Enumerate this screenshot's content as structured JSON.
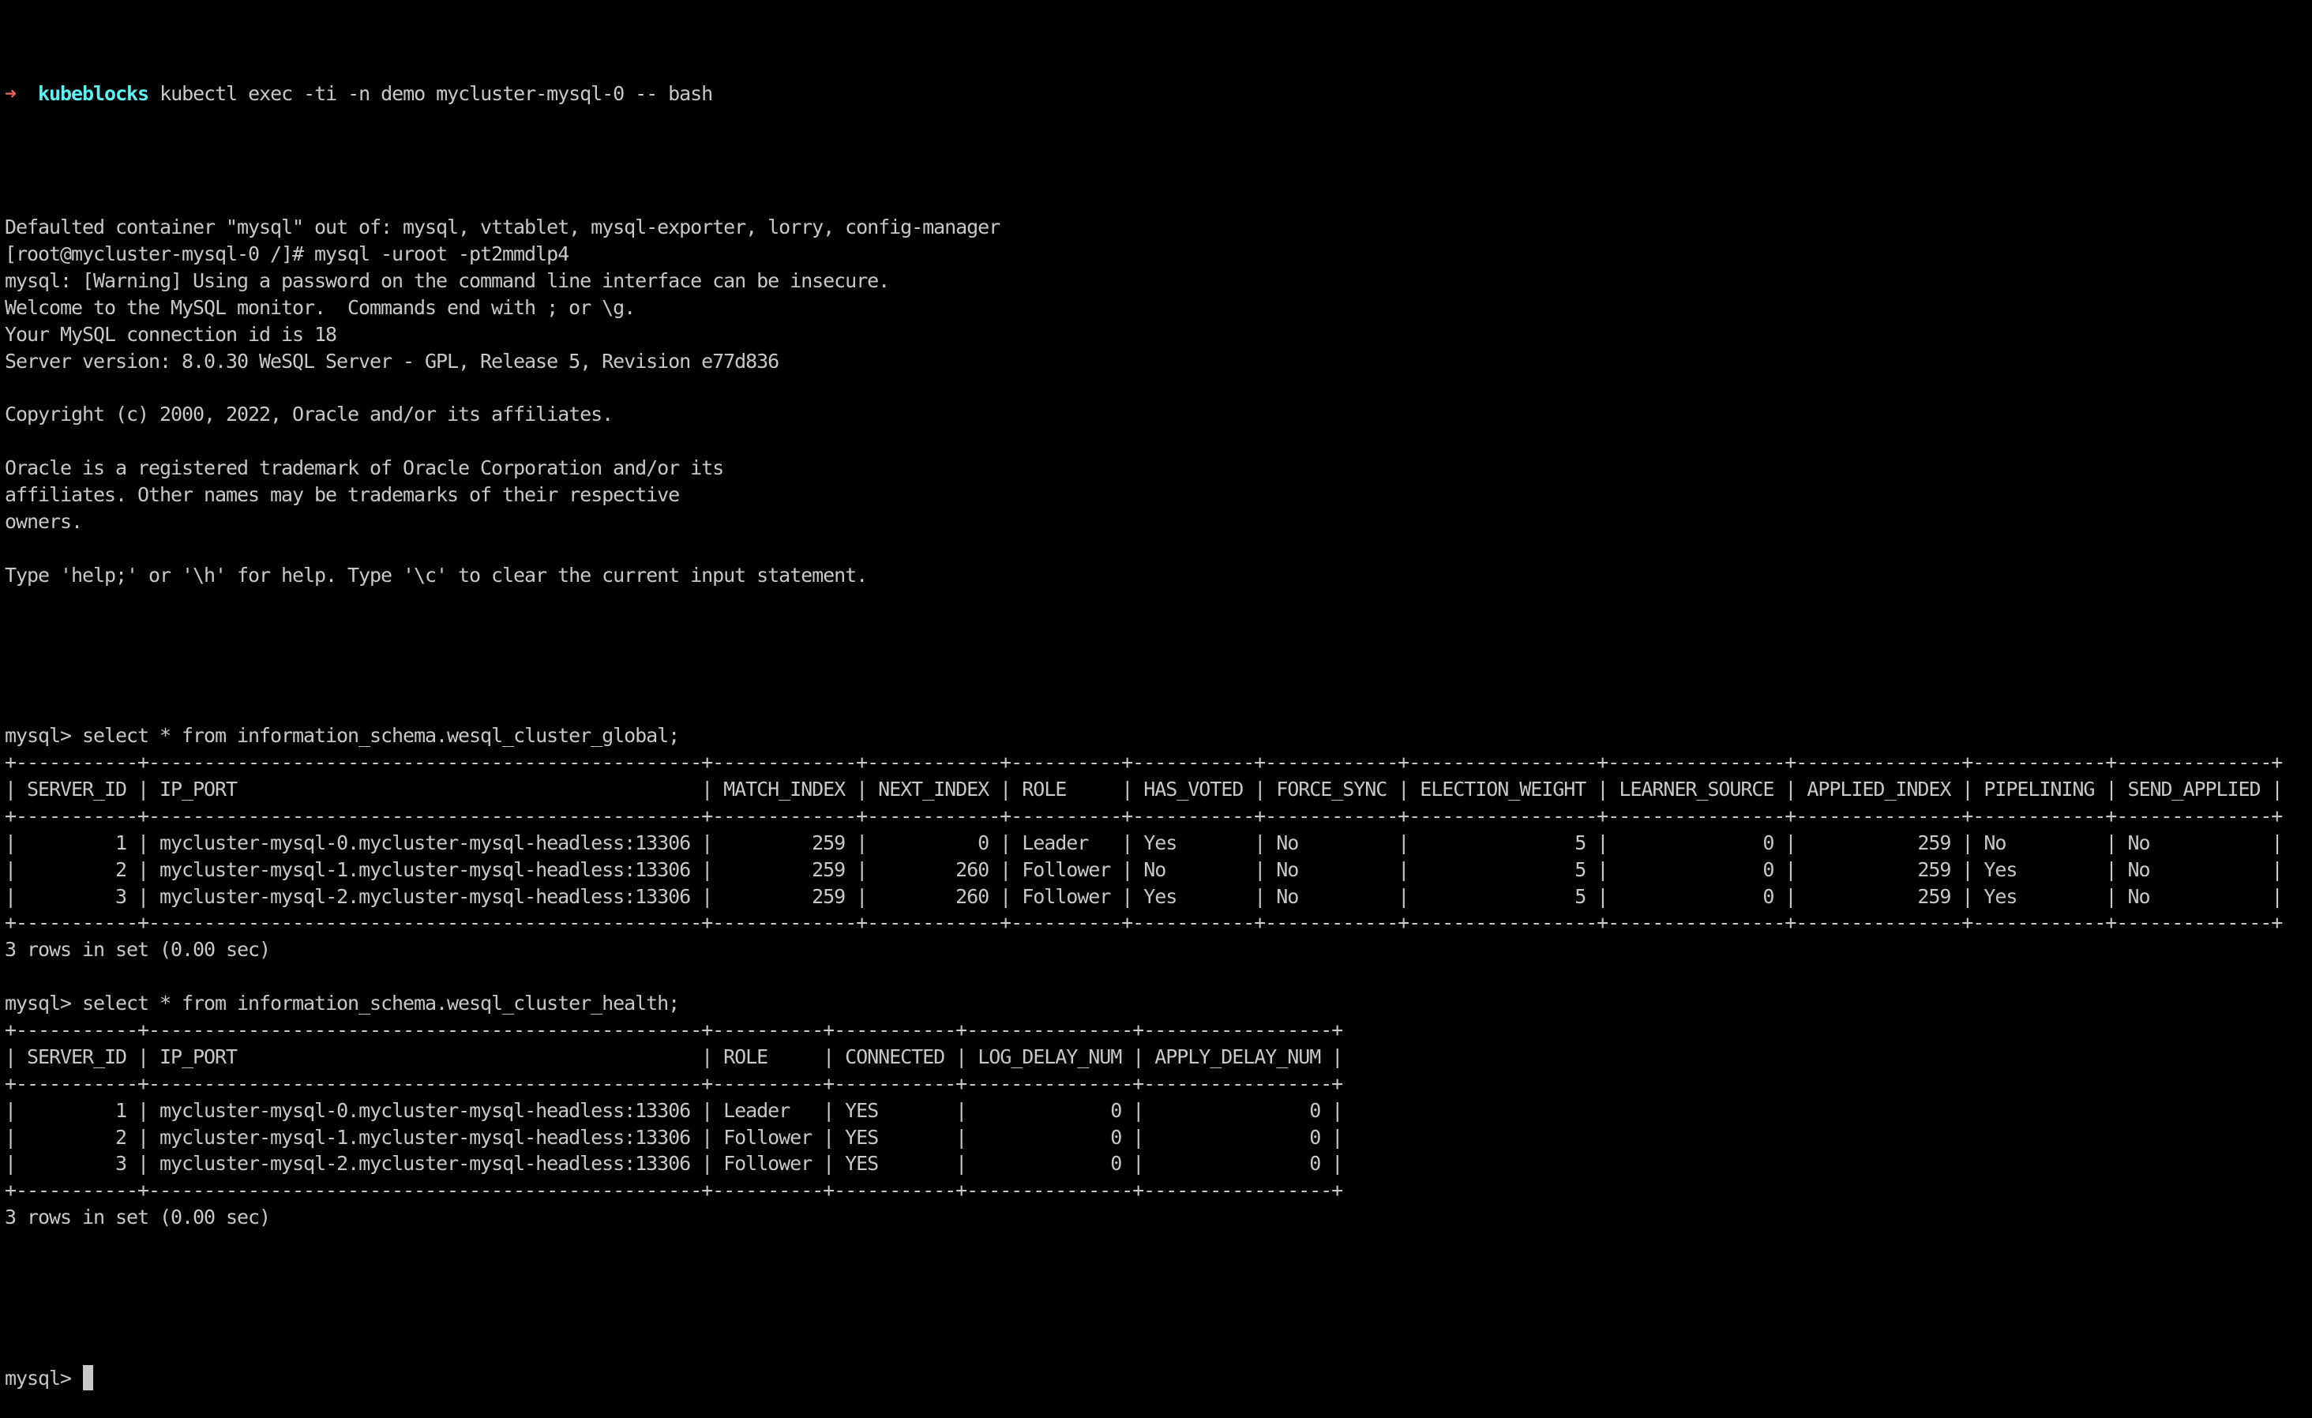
{
  "terminal": {
    "colors": {
      "background": "#000000",
      "foreground": "#c8c8c8",
      "prompt_arrow": "#f2655d",
      "prompt_dir": "#5cf3f3"
    },
    "shell_prompt": {
      "arrow": "➜",
      "directory": "kubeblocks",
      "command": "kubectl exec -ti -n demo mycluster-mysql-0 -- bash"
    },
    "pre_lines": [
      "Defaulted container \"mysql\" out of: mysql, vttablet, mysql-exporter, lorry, config-manager",
      "[root@mycluster-mysql-0 /]# mysql -uroot -pt2mmdlp4",
      "mysql: [Warning] Using a password on the command line interface can be insecure.",
      "Welcome to the MySQL monitor.  Commands end with ; or \\g.",
      "Your MySQL connection id is 18",
      "Server version: 8.0.30 WeSQL Server - GPL, Release 5, Revision e77d836",
      "",
      "Copyright (c) 2000, 2022, Oracle and/or its affiliates.",
      "",
      "Oracle is a registered trademark of Oracle Corporation and/or its",
      "affiliates. Other names may be trademarks of their respective",
      "owners.",
      "",
      "Type 'help;' or '\\h' for help. Type '\\c' to clear the current input statement.",
      ""
    ],
    "mysql_prompt": "mysql> ",
    "queries": [
      {
        "statement": "select * from information_schema.wesql_cluster_global;",
        "columns": [
          {
            "name": "SERVER_ID",
            "align": "right"
          },
          {
            "name": "IP_PORT",
            "align": "left"
          },
          {
            "name": "MATCH_INDEX",
            "align": "right"
          },
          {
            "name": "NEXT_INDEX",
            "align": "right"
          },
          {
            "name": "ROLE",
            "align": "left"
          },
          {
            "name": "HAS_VOTED",
            "align": "left"
          },
          {
            "name": "FORCE_SYNC",
            "align": "left"
          },
          {
            "name": "ELECTION_WEIGHT",
            "align": "right"
          },
          {
            "name": "LEARNER_SOURCE",
            "align": "right"
          },
          {
            "name": "APPLIED_INDEX",
            "align": "right"
          },
          {
            "name": "PIPELINING",
            "align": "left"
          },
          {
            "name": "SEND_APPLIED",
            "align": "left"
          }
        ],
        "rows": [
          [
            "1",
            "mycluster-mysql-0.mycluster-mysql-headless:13306",
            "259",
            "0",
            "Leader",
            "Yes",
            "No",
            "5",
            "0",
            "259",
            "No",
            "No"
          ],
          [
            "2",
            "mycluster-mysql-1.mycluster-mysql-headless:13306",
            "259",
            "260",
            "Follower",
            "No",
            "No",
            "5",
            "0",
            "259",
            "Yes",
            "No"
          ],
          [
            "3",
            "mycluster-mysql-2.mycluster-mysql-headless:13306",
            "259",
            "260",
            "Follower",
            "Yes",
            "No",
            "5",
            "0",
            "259",
            "Yes",
            "No"
          ]
        ],
        "result_summary": "3 rows in set (0.00 sec)"
      },
      {
        "statement": "select * from information_schema.wesql_cluster_health;",
        "columns": [
          {
            "name": "SERVER_ID",
            "align": "right"
          },
          {
            "name": "IP_PORT",
            "align": "left"
          },
          {
            "name": "ROLE",
            "align": "left"
          },
          {
            "name": "CONNECTED",
            "align": "left"
          },
          {
            "name": "LOG_DELAY_NUM",
            "align": "right"
          },
          {
            "name": "APPLY_DELAY_NUM",
            "align": "right"
          }
        ],
        "rows": [
          [
            "1",
            "mycluster-mysql-0.mycluster-mysql-headless:13306",
            "Leader",
            "YES",
            "0",
            "0"
          ],
          [
            "2",
            "mycluster-mysql-1.mycluster-mysql-headless:13306",
            "Follower",
            "YES",
            "0",
            "0"
          ],
          [
            "3",
            "mycluster-mysql-2.mycluster-mysql-headless:13306",
            "Follower",
            "YES",
            "0",
            "0"
          ]
        ],
        "result_summary": "3 rows in set (0.00 sec)"
      }
    ],
    "input": {
      "current_value": ""
    }
  }
}
